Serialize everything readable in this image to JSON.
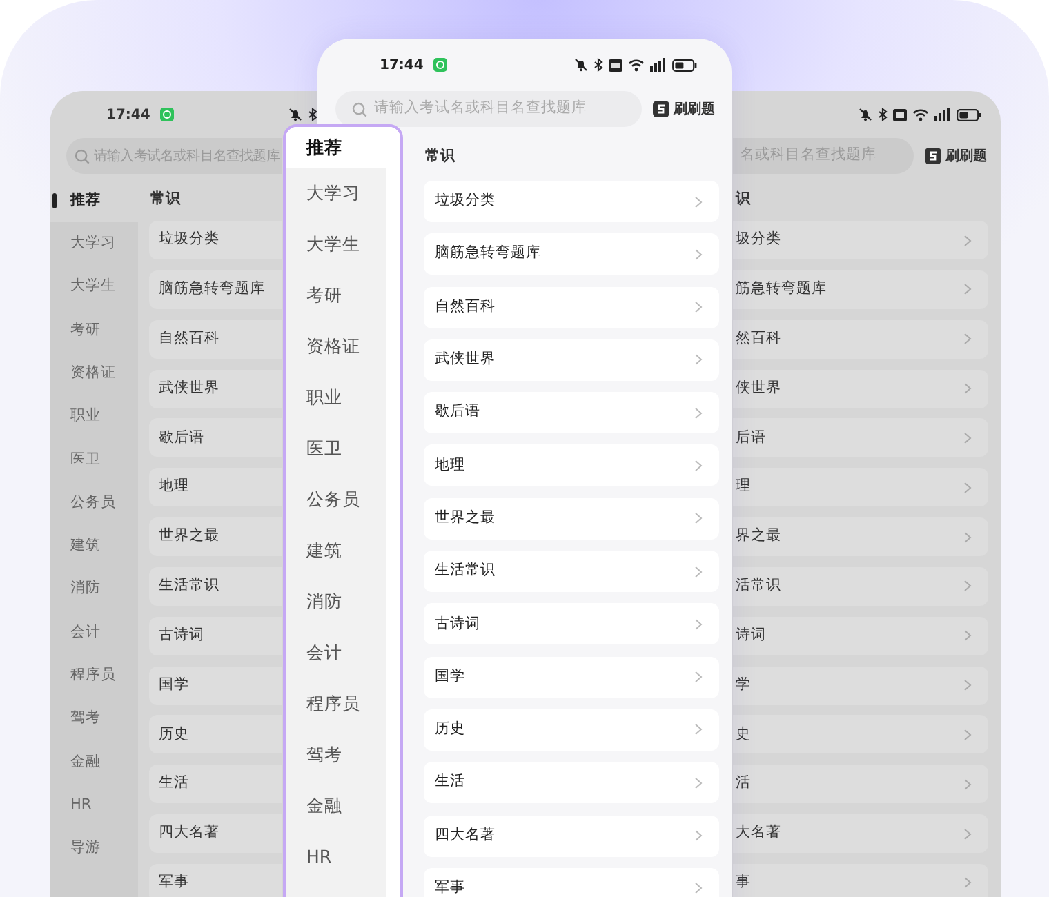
{
  "phones": [
    {
      "kind": "background-left",
      "status": {
        "time": "17:44"
      },
      "search": {
        "placeholder": "请输入考试名或科目名查找题库"
      },
      "sidebar": [
        {
          "label": "推荐",
          "selected": true
        },
        {
          "label": "大学习",
          "selected": false
        },
        {
          "label": "大学生",
          "selected": false
        },
        {
          "label": "考研",
          "selected": false
        },
        {
          "label": "资格证",
          "selected": false
        },
        {
          "label": "职业",
          "selected": false
        },
        {
          "label": "医卫",
          "selected": false
        },
        {
          "label": "公务员",
          "selected": false
        },
        {
          "label": "建筑",
          "selected": false
        },
        {
          "label": "消防",
          "selected": false
        },
        {
          "label": "会计",
          "selected": false
        },
        {
          "label": "程序员",
          "selected": false
        },
        {
          "label": "驾考",
          "selected": false
        },
        {
          "label": "金融",
          "selected": false
        },
        {
          "label": "HR",
          "selected": false
        },
        {
          "label": "导游",
          "selected": false
        }
      ],
      "section": "常识",
      "topics": [
        "垃圾分类",
        "脑筋急转弯题库",
        "自然百科",
        "武侠世界",
        "歇后语",
        "地理",
        "世界之最",
        "生活常识",
        "古诗词",
        "国学",
        "历史",
        "生活",
        "四大名著",
        "军事"
      ]
    },
    {
      "kind": "front",
      "status": {
        "time": "17:44"
      },
      "search": {
        "placeholder": "请输入考试名或科目名查找题库"
      },
      "brand": "刷刷题",
      "sidebar": [
        {
          "label": "推荐",
          "selected": true
        },
        {
          "label": "大学习",
          "selected": false
        },
        {
          "label": "大学生",
          "selected": false
        },
        {
          "label": "考研",
          "selected": false
        },
        {
          "label": "资格证",
          "selected": false
        },
        {
          "label": "职业",
          "selected": false
        },
        {
          "label": "医卫",
          "selected": false
        },
        {
          "label": "公务员",
          "selected": false
        },
        {
          "label": "建筑",
          "selected": false
        },
        {
          "label": "消防",
          "selected": false
        },
        {
          "label": "会计",
          "selected": false
        },
        {
          "label": "程序员",
          "selected": false
        },
        {
          "label": "驾考",
          "selected": false
        },
        {
          "label": "金融",
          "selected": false
        },
        {
          "label": "HR",
          "selected": false
        }
      ],
      "section": "常识",
      "topics": [
        "垃圾分类",
        "脑筋急转弯题库",
        "自然百科",
        "武侠世界",
        "歇后语",
        "地理",
        "世界之最",
        "生活常识",
        "古诗词",
        "国学",
        "历史",
        "生活",
        "四大名著",
        "军事"
      ]
    },
    {
      "kind": "background-right",
      "search": {
        "placeholder": "名或科目名查找题库"
      },
      "brand": "刷刷题",
      "section": "识",
      "topics": [
        "圾分类",
        "筋急转弯题库",
        "然百科",
        "侠世界",
        "后语",
        "理",
        "界之最",
        "活常识",
        "诗词",
        "学",
        "史",
        "活",
        "大名著",
        "事"
      ]
    }
  ]
}
